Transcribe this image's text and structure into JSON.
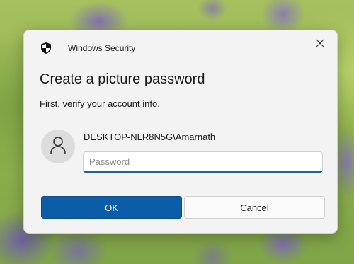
{
  "dialog": {
    "app_title": "Windows Security",
    "heading": "Create a picture password",
    "subtext": "First, verify your account info.",
    "account_name": "DESKTOP-NLR8N5G\\Amarnath",
    "password": {
      "value": "",
      "placeholder": "Password"
    },
    "ok_label": "OK",
    "cancel_label": "Cancel"
  },
  "icons": {
    "app": "shield-icon",
    "close": "close-icon",
    "avatar": "user-icon"
  },
  "colors": {
    "primary_button": "#0c5ca8",
    "input_focus_underline": "#1f5fa6",
    "dialog_background": "#f3f3f3"
  }
}
